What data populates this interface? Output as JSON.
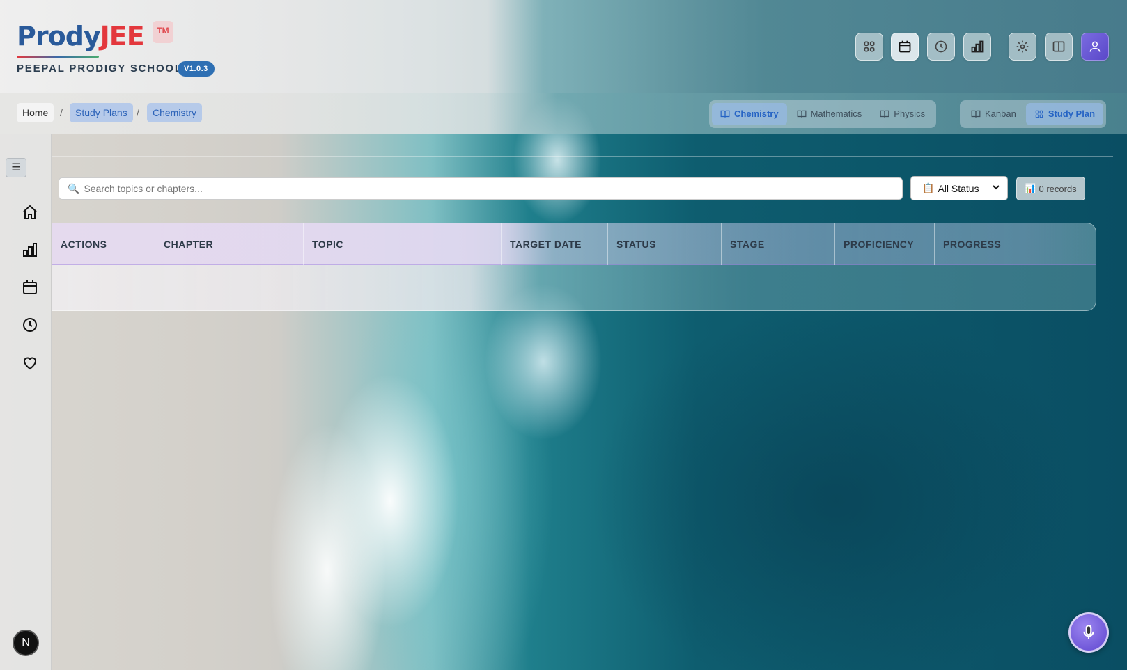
{
  "header": {
    "logo_part1": "Prody",
    "logo_part2": "JEE",
    "trademark": "TM",
    "school_name": "PEEPAL PRODIGY SCHOOL",
    "version": "V1.0.3",
    "toolbar_icons": [
      "grid-icon",
      "calendar-icon",
      "clock-icon",
      "chart-icon",
      "gear-icon",
      "columns-icon",
      "user-icon"
    ]
  },
  "breadcrumb": {
    "home": "Home",
    "separator": "/",
    "study_plans": "Study Plans",
    "current": "Chemistry"
  },
  "subjects": {
    "items": [
      "Chemistry",
      "Mathematics",
      "Physics"
    ],
    "active": "Chemistry"
  },
  "views": {
    "kanban": "Kanban",
    "study_plan": "Study Plan",
    "active": "Study Plan"
  },
  "sidebar": {
    "toggle": "☰",
    "icons": [
      "home-icon",
      "chart-icon",
      "calendar-icon",
      "clock-icon",
      "heart-icon"
    ],
    "badge": "N"
  },
  "filters": {
    "search_placeholder": "Search topics or chapters...",
    "status_value": "All Status",
    "records": "0 records"
  },
  "table": {
    "columns": [
      "ACTIONS",
      "CHAPTER",
      "TOPIC",
      "TARGET DATE",
      "STATUS",
      "STAGE",
      "PROFICIENCY",
      "PROGRESS"
    ],
    "rows": []
  },
  "colors": {
    "brand_blue": "#2a5a9a",
    "brand_red": "#e3383d",
    "accent_active": "#2563c4",
    "version_badge": "#2e6fb3",
    "fab_purple": "#6a52d6"
  }
}
